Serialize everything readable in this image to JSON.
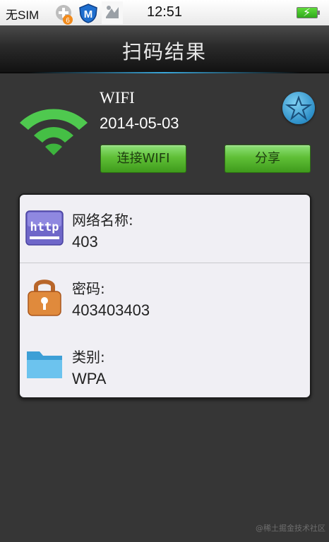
{
  "status_bar": {
    "carrier": "无SIM",
    "notification_badge": "6",
    "time": "12:51"
  },
  "header": {
    "title": "扫码结果"
  },
  "wifi_summary": {
    "ssid": "WIFI",
    "date": "2014-05-03",
    "connect_label": "连接WIFI",
    "share_label": "分享"
  },
  "details": {
    "network_name": {
      "label": "网络名称:",
      "value": "403",
      "icon": "http-icon"
    },
    "password": {
      "label": "密码:",
      "value": "403403403",
      "icon": "lock-icon"
    },
    "type": {
      "label": "类别:",
      "value": "WPA",
      "icon": "folder-icon"
    }
  },
  "watermark": "@稀土掘金技术社区",
  "colors": {
    "background": "#363636",
    "button_green": "#5fbf36",
    "wifi_green": "#4fc94f",
    "card_background": "#f0eff4"
  }
}
